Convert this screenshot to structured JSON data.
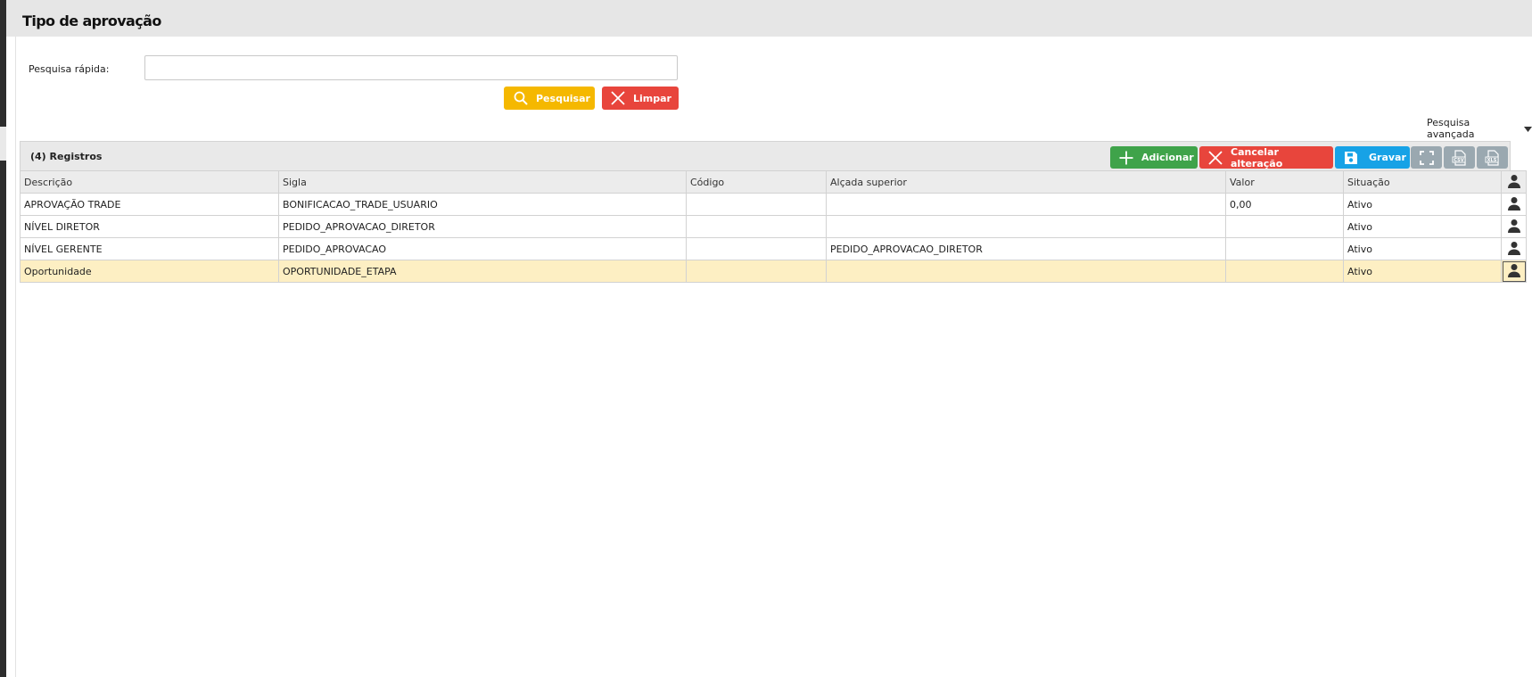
{
  "page": {
    "title": "Tipo de aprovação"
  },
  "search": {
    "label": "Pesquisa rápida:",
    "value": "",
    "search_button": "Pesquisar",
    "clear_button": "Limpar",
    "advanced_label": "Pesquisa avançada"
  },
  "grid": {
    "count_label": "(4) Registros",
    "toolbar": {
      "add": "Adicionar",
      "cancel": "Cancelar alteração",
      "save": "Gravar",
      "fullscreen_icon": "fullscreen-icon",
      "csv_icon": "csv-icon",
      "xls_icon": "xls-icon"
    },
    "columns": [
      "Descrição",
      "Sigla",
      "Código",
      "Alçada superior",
      "Valor",
      "Situação"
    ],
    "rows": [
      {
        "descricao": "APROVAÇÃO TRADE",
        "sigla": "BONIFICACAO_TRADE_USUARIO",
        "codigo": "",
        "alcada": "",
        "valor": "0,00",
        "situacao": "Ativo"
      },
      {
        "descricao": "NÍVEL DIRETOR",
        "sigla": "PEDIDO_APROVACAO_DIRETOR",
        "codigo": "",
        "alcada": "",
        "valor": "",
        "situacao": "Ativo"
      },
      {
        "descricao": "NÍVEL GERENTE",
        "sigla": "PEDIDO_APROVACAO",
        "codigo": "",
        "alcada": "PEDIDO_APROVACAO_DIRETOR",
        "valor": "",
        "situacao": "Ativo"
      },
      {
        "descricao": "Oportunidade",
        "sigla": "OPORTUNIDADE_ETAPA",
        "codigo": "",
        "alcada": "",
        "valor": "",
        "situacao": "Ativo"
      }
    ],
    "selected_row": 3
  },
  "colors": {
    "search": "#f5b800",
    "clear": "#e8453c",
    "add": "#3fa34a",
    "save": "#17a2e6",
    "selected_row": "#fdefc3"
  }
}
